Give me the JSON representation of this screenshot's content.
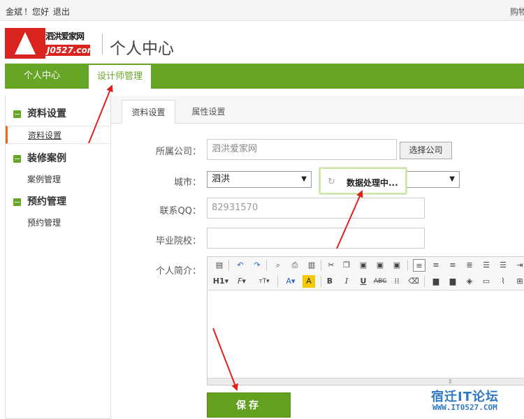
{
  "topbar": {
    "user": "金斌",
    "greeting": "！您好",
    "logout": "退出",
    "cart": "购物"
  },
  "header": {
    "logo_name": "泗洪爱家网",
    "logo_domain": "J0527.com",
    "title": "个人中心"
  },
  "nav": {
    "home": "个人中心",
    "designer": "设计师管理"
  },
  "sidebar": {
    "groups": [
      {
        "label": "资料设置",
        "items": [
          "资料设置"
        ]
      },
      {
        "label": "装修案例",
        "items": [
          "案例管理"
        ]
      },
      {
        "label": "预约管理",
        "items": [
          "预约管理"
        ]
      }
    ]
  },
  "tabs": {
    "profile": "资料设置",
    "attributes": "属性设置"
  },
  "form": {
    "company_label": "所属公司：",
    "company_value": "泗洪爱家网",
    "choose_company": "选择公司",
    "city_label": "城市：",
    "city_value": "泗洪",
    "qq_label": "联系QQ：",
    "qq_value": "82931570",
    "school_label": "毕业院校：",
    "school_value": "",
    "intro_label": "个人简介：",
    "save": "保存"
  },
  "toast": {
    "message": "数据处理中..."
  },
  "editor_toolbar": {
    "heading": "H1",
    "font": "F",
    "size": "тT",
    "font_color": "A",
    "highlight": "A",
    "bold": "B",
    "italic": "I",
    "underline": "U",
    "strike": "ABC"
  },
  "watermark": {
    "title": "宿迁IT论坛",
    "url": "WWW.IT0527.COM"
  },
  "colors": {
    "nav_green": "#67a526",
    "save_green": "#63a01f",
    "active_orange": "#e86a1a",
    "arrow_red": "#e0201b",
    "logo_red": "#d8231f"
  }
}
